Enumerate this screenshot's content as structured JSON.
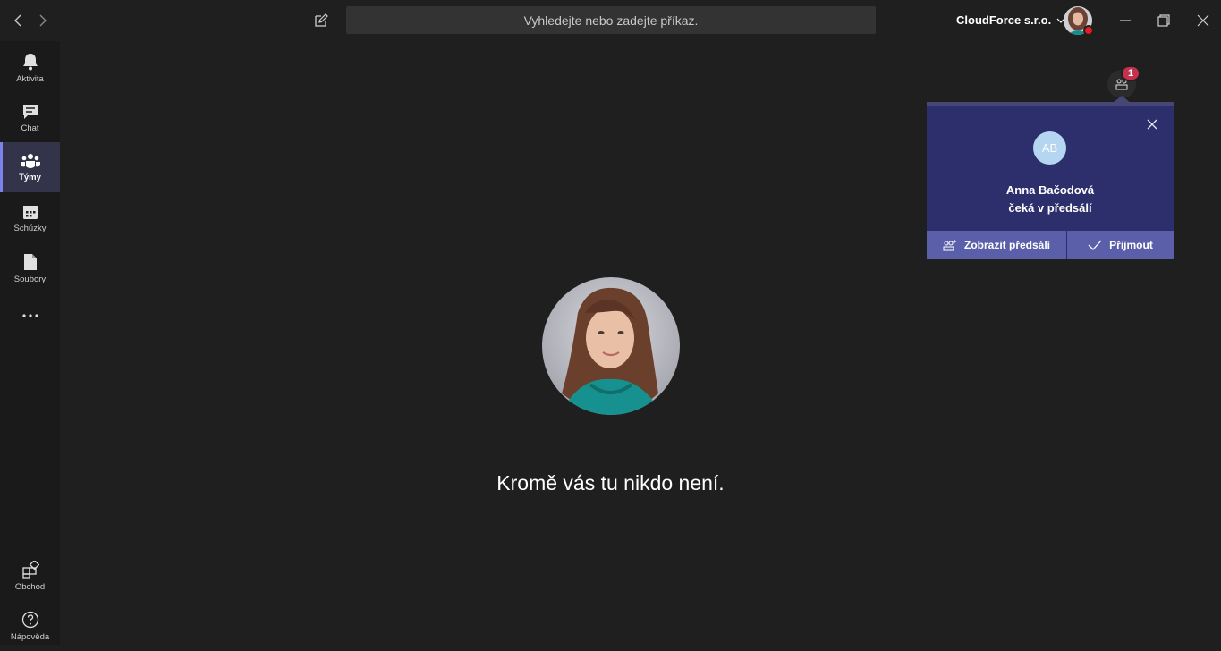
{
  "titlebar": {
    "search_placeholder": "Vyhledejte nebo zadejte příkaz.",
    "org_name": "CloudForce s.r.o."
  },
  "rail": {
    "items": [
      {
        "label": "Aktivita",
        "icon": "bell-icon"
      },
      {
        "label": "Chat",
        "icon": "chat-icon"
      },
      {
        "label": "Týmy",
        "icon": "teams-icon",
        "active": true
      },
      {
        "label": "Schůzky",
        "icon": "calendar-icon"
      },
      {
        "label": "Soubory",
        "icon": "file-icon"
      },
      {
        "label": "",
        "icon": "more-icon"
      }
    ],
    "bottom": [
      {
        "label": "Obchod",
        "icon": "store-icon"
      },
      {
        "label": "Nápověda",
        "icon": "help-icon"
      }
    ]
  },
  "meeting": {
    "empty_message": "Kromě vás tu nikdo není."
  },
  "lobby": {
    "badge_count": "1",
    "toast": {
      "initials": "AB",
      "name": "Anna Bačodová",
      "message": "čeká v předsálí",
      "view_label": "Zobrazit předsálí",
      "admit_label": "Přijmout"
    }
  },
  "colors": {
    "accent": "#5b5fa9",
    "toast_bg": "#2d2f6c",
    "badge": "#c4314b",
    "status_busy": "#e81b23"
  }
}
